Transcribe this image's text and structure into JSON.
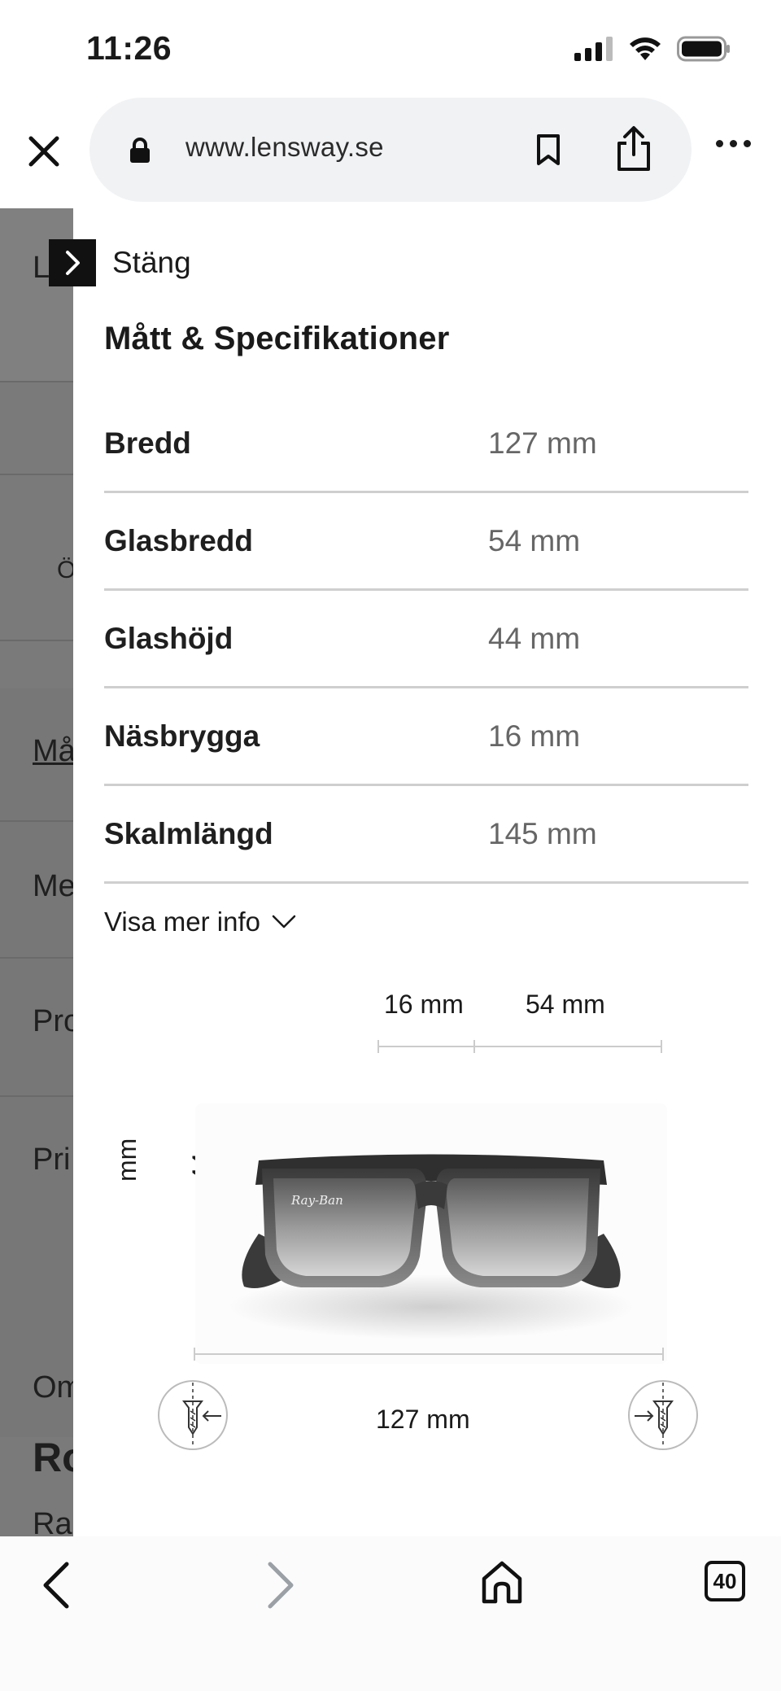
{
  "status_bar": {
    "time": "11:26",
    "icons": [
      "signal-icon",
      "wifi-icon",
      "battery-icon"
    ]
  },
  "browser": {
    "url": "www.lensway.se",
    "icons": [
      "close-icon",
      "lock-icon",
      "bookmark-icon",
      "share-icon",
      "more-icon"
    ]
  },
  "underlay": {
    "labels": [
      "L",
      "Ö",
      "Må",
      "Me",
      "Pro",
      "Pri",
      "Om",
      "Ro",
      "Ra"
    ]
  },
  "drawer": {
    "close_label": "Stäng",
    "title": "Mått & Specifikationer",
    "specs": [
      {
        "label": "Bredd",
        "value": "127 mm"
      },
      {
        "label": "Glasbredd",
        "value": "54 mm"
      },
      {
        "label": "Glashöjd",
        "value": "44 mm"
      },
      {
        "label": "Näsbrygga",
        "value": "16 mm"
      },
      {
        "label": "Skalmlängd",
        "value": "145 mm"
      }
    ],
    "more_info": "Visa mer info"
  },
  "diagram": {
    "bridge": "16 mm",
    "lens_width": "54 mm",
    "lens_height_unit": "mm",
    "lens_height_value": "44",
    "total_width": "127 mm",
    "brand_mark": "Ray-Ban"
  },
  "bottom_bar": {
    "tab_count": "40",
    "icons": [
      "back-icon",
      "forward-icon",
      "home-icon",
      "tabs-icon"
    ]
  },
  "colors": {
    "accent": "#111111",
    "divider": "#cfcfcf",
    "value_text": "#666666",
    "url_pill": "#f0f2f4",
    "overlay": "#7a7a7a"
  }
}
